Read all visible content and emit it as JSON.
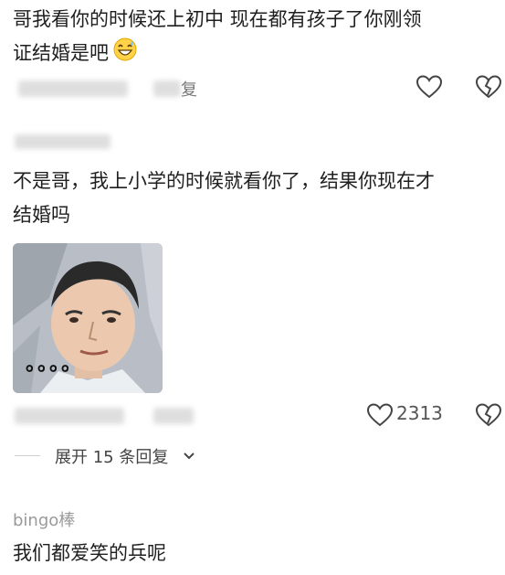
{
  "comment1": {
    "text_line1": "哥我看你的时候还上初中 现在都有孩子了你刚领",
    "text_line2": "证结婚是吧",
    "emoji_icon": "grinning-sweat-emoji",
    "reply_label_fragment": "复"
  },
  "comment2": {
    "text_line1": "不是哥，我上小学的时候就看你了，结果你现在才",
    "text_line2": "结婚吗",
    "image_caption": "。。。。",
    "like_count": "2313",
    "expand_replies": "展开 15 条回复"
  },
  "comment3": {
    "username": "bingo棒",
    "text": "我们都爱笑的兵呢"
  },
  "icons": {
    "like": "heart-outline-icon",
    "dislike": "broken-heart-icon",
    "expand": "chevron-down-icon"
  }
}
